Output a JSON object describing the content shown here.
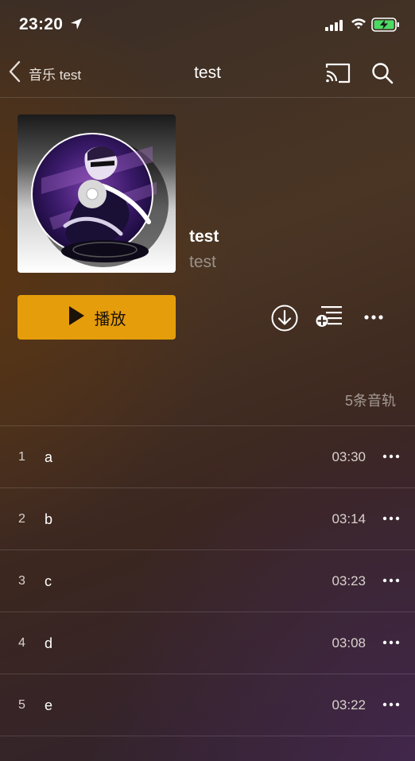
{
  "status_bar": {
    "time": "23:20",
    "icons": [
      "location-arrow-icon",
      "cellular-signal-icon",
      "wifi-icon",
      "battery-charging-icon"
    ]
  },
  "nav": {
    "back_label": "音乐 test",
    "title": "test",
    "icons": [
      "back-chevron-icon",
      "cast-icon",
      "search-icon"
    ]
  },
  "album": {
    "title": "test",
    "artist": "test",
    "cover_icon": "dj-vinyl-cover-art"
  },
  "actions": {
    "play_label": "播放",
    "icons": [
      "play-icon",
      "download-icon",
      "add-to-playlist-icon",
      "more-icon"
    ]
  },
  "track_count_label": "5条音轨",
  "tracks": [
    {
      "number": "1",
      "name": "a",
      "duration": "03:30"
    },
    {
      "number": "2",
      "name": "b",
      "duration": "03:14"
    },
    {
      "number": "3",
      "name": "c",
      "duration": "03:23"
    },
    {
      "number": "4",
      "name": "d",
      "duration": "03:08"
    },
    {
      "number": "5",
      "name": "e",
      "duration": "03:22"
    }
  ],
  "colors": {
    "accent": "#e59d0b",
    "secondary_text": "#9b928b"
  }
}
